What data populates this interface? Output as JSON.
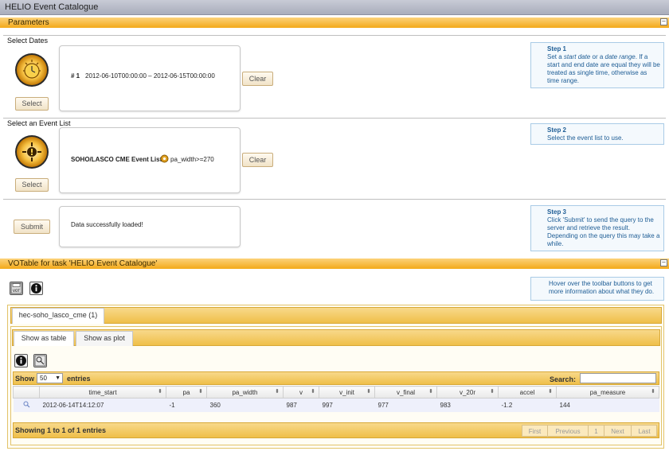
{
  "window": {
    "title": "HELIO Event Catalogue"
  },
  "parameters": {
    "header": "Parameters",
    "select_dates": {
      "label": "Select Dates",
      "select_button": "Select",
      "entry_number": "# 1",
      "entry_value": "2012-06-10T00:00:00 – 2012-06-15T00:00:00",
      "clear_button": "Clear"
    },
    "select_event_list": {
      "label": "Select an Event List",
      "select_button": "Select",
      "entry_value": "SOHO/LASCO CME Event List",
      "entry_condition": "pa_width>=270",
      "clear_button": "Clear"
    },
    "submit": {
      "submit_button": "Submit",
      "message": "Data successfully loaded!"
    },
    "steps": [
      {
        "title": "Step 1",
        "text_before": "Set a ",
        "em1": "start date",
        "mid": " or a ",
        "em2": "date range",
        "text_after": ". If a start and end date are equal they will be treated as single time, otherwise as time range."
      },
      {
        "title": "Step 2",
        "text": "Select the event list to use."
      },
      {
        "title": "Step 3",
        "text": "Click 'Submit' to send the query to the server and retrieve the result. Depending on the query this may take a while."
      }
    ]
  },
  "votable": {
    "header": "VOTable for task 'HELIO Event Catalogue'",
    "hint": "Hover over the toolbar buttons to get more information about what they do.",
    "table_tab": "hec-soho_lasco_cme (1)",
    "view_tabs": [
      "Show as table",
      "Show as plot"
    ],
    "show_label": "Show",
    "show_value": "50",
    "entries_label": "entries",
    "search_label": "Search:",
    "search_value": "",
    "columns": [
      "time_start",
      "pa",
      "pa_width",
      "v",
      "v_init",
      "v_final",
      "v_20r",
      "accel",
      "pa_measure"
    ],
    "rows": [
      [
        "2012-06-14T14:12:07",
        "-1",
        "360",
        "987",
        "997",
        "977",
        "983",
        "-1.2",
        "144"
      ]
    ],
    "footer_info": "Showing 1 to 1 of 1 entries",
    "pager": [
      "First",
      "Previous",
      "1",
      "Next",
      "Last"
    ]
  },
  "colors": {
    "section_orange": "#f3a919",
    "step_blue": "#1e5d95",
    "row_highlight": "#eef0fb"
  },
  "icons": {
    "dates": "clock-sun-icon",
    "event_list": "sun-event-icon",
    "votable_save": "vot-save-icon",
    "info": "info-icon",
    "row_action": "magnifier-icon"
  }
}
